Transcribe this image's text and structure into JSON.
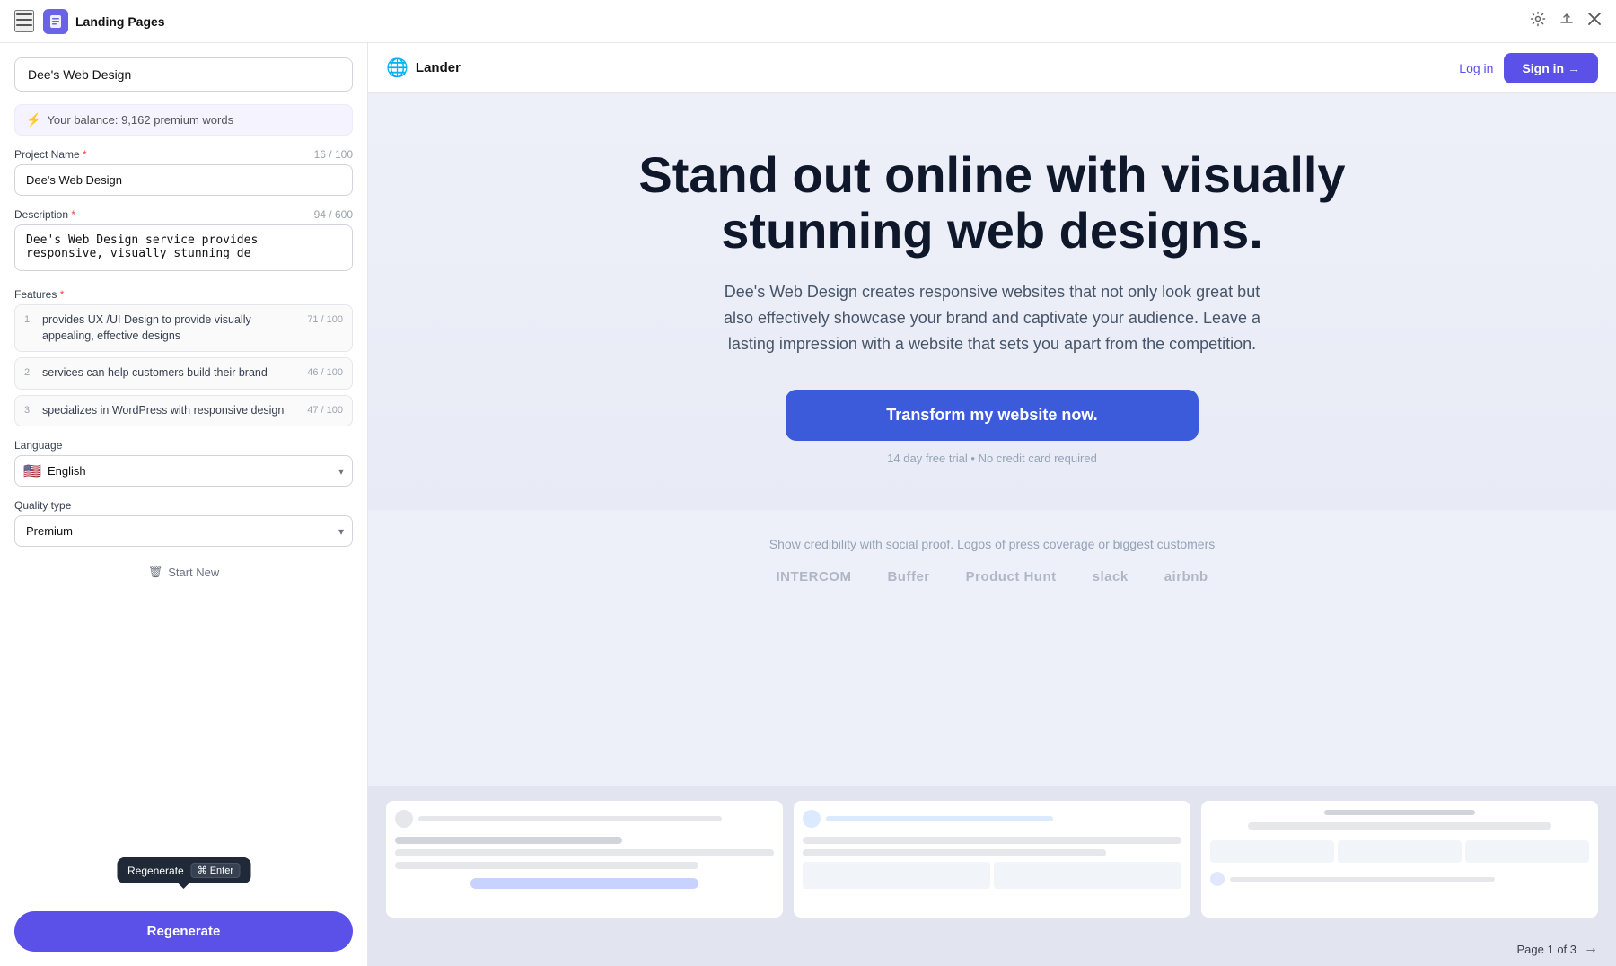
{
  "topbar": {
    "title": "Landing Pages",
    "menu_icon": "☰",
    "logo_icon": "📄",
    "globe_icon": "⚙",
    "upload_icon": "⬆",
    "close_icon": "✕"
  },
  "left_panel": {
    "project_title_placeholder": "Dee's Web Design",
    "project_title_value": "Dee's Web Design",
    "balance_label": "Your balance: 9,162 premium words",
    "project_name_label": "Project Name",
    "project_name_required": "*",
    "project_name_counter": "16 / 100",
    "project_name_value": "Dee's Web Design",
    "description_label": "Description",
    "description_required": "*",
    "description_counter": "94 / 600",
    "description_value": "Dee's Web Design service provides responsive, visually stunning de",
    "features_label": "Features",
    "features_required": "*",
    "features": [
      {
        "num": "1",
        "text": "provides UX /UI Design to provide visually appealing, effective designs",
        "counter": "71 / 100"
      },
      {
        "num": "2",
        "text": "services can help customers build their brand",
        "counter": "46 / 100"
      },
      {
        "num": "3",
        "text": "specializes in WordPress with responsive design",
        "counter": "47 / 100"
      }
    ],
    "language_label": "Language",
    "language_value": "English",
    "language_flag": "🇺🇸",
    "quality_label": "Quality type",
    "quality_value": "Premium",
    "start_new_label": "Start New",
    "regenerate_label": "Regenerate",
    "tooltip": {
      "label": "Regenerate",
      "cmd_icon": "⌘",
      "enter_label": "Enter"
    }
  },
  "preview": {
    "logo_text": "Lander",
    "login_label": "Log in",
    "signin_label": "Sign in →",
    "hero_headline": "Stand out online with visually stunning web designs.",
    "hero_subtext": "Dee's Web Design creates responsive websites that not only look great but also effectively showcase your brand and captivate your audience. Leave a lasting impression with a website that sets you apart from the competition.",
    "cta_label": "Transform my website now.",
    "cta_note": "14 day free trial • No credit card required",
    "social_proof_text": "Show credibility with social proof. Logos of press coverage or biggest customers",
    "logos": [
      {
        "icon": "▦",
        "name": "INTERCOM"
      },
      {
        "icon": "⬡",
        "name": "Buffer"
      },
      {
        "icon": "⬤",
        "name": "Product Hunt"
      },
      {
        "icon": "#",
        "name": "slack"
      },
      {
        "icon": "◇",
        "name": "airbnb"
      }
    ],
    "page_label": "Page 1 of 3"
  }
}
